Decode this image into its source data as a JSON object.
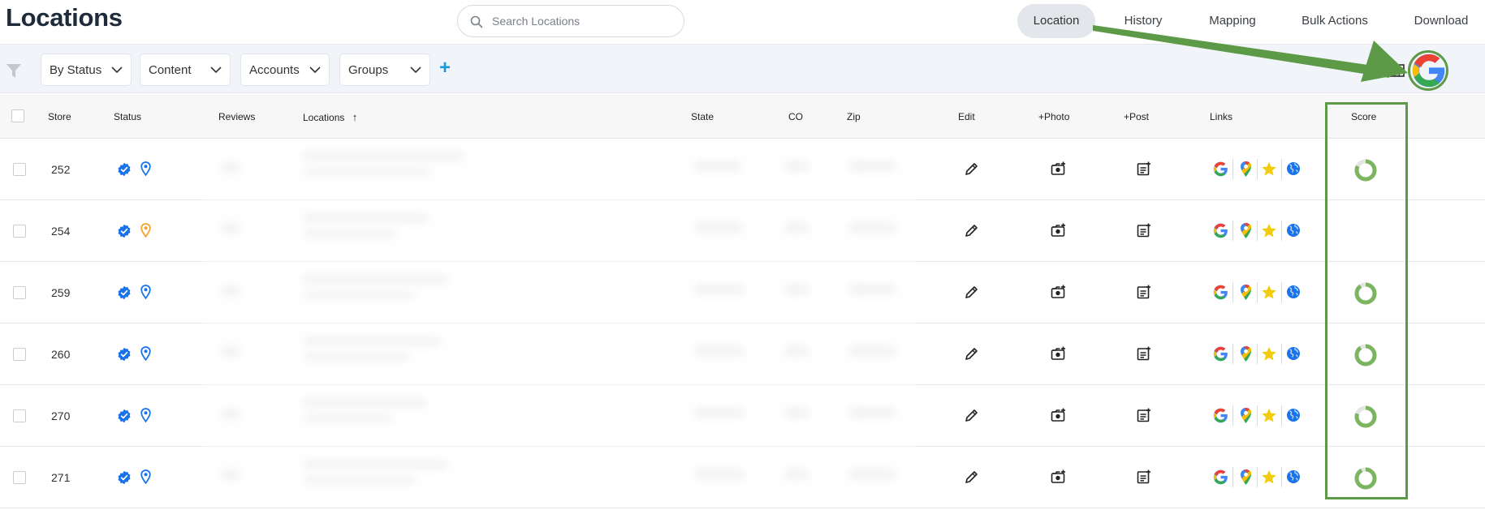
{
  "page": {
    "title": "Locations"
  },
  "search": {
    "placeholder": "Search Locations"
  },
  "nav": {
    "tabs": [
      {
        "label": "Location",
        "active": true
      },
      {
        "label": "History"
      },
      {
        "label": "Mapping"
      },
      {
        "label": "Bulk Actions"
      },
      {
        "label": "Download"
      }
    ]
  },
  "filters": {
    "dropdowns": [
      {
        "label": "By Status"
      },
      {
        "label": "Content"
      },
      {
        "label": "Accounts"
      },
      {
        "label": "Groups"
      }
    ],
    "add_label": "+"
  },
  "table": {
    "columns": {
      "store": "Store",
      "status": "Status",
      "reviews": "Reviews",
      "locations": "Locations",
      "state": "State",
      "co": "CO",
      "zip": "Zip",
      "edit": "Edit",
      "photo": "+Photo",
      "post": "+Post",
      "links": "Links",
      "score": "Score"
    },
    "sort_indicator": "↑",
    "rows": [
      {
        "store": "252",
        "pin_color": "#1a73e8",
        "score": 0.82
      },
      {
        "store": "254",
        "pin_color": "#f4a22d",
        "score": null
      },
      {
        "store": "259",
        "pin_color": "#1a73e8",
        "score": 0.9
      },
      {
        "store": "260",
        "pin_color": "#1a73e8",
        "score": 0.9
      },
      {
        "store": "270",
        "pin_color": "#1a73e8",
        "score": 0.8
      },
      {
        "store": "271",
        "pin_color": "#1a73e8",
        "score": 0.92
      }
    ]
  },
  "icons": {
    "search": "search-icon",
    "filter": "filter-icon",
    "chevron": "chevron-down-icon",
    "verified": "verified-badge-icon",
    "pin": "map-pin-icon",
    "edit": "pencil-icon",
    "photo": "add-photo-icon",
    "post": "add-post-icon",
    "google": "google-icon",
    "maps": "google-maps-icon",
    "star": "star-icon",
    "globe": "globe-icon",
    "grid": "grid-icon"
  },
  "colors": {
    "accent_blue": "#1a73e8",
    "annotation_green": "#5d9a48",
    "score_green": "#7cb55f",
    "star_yellow": "#f2cc0c"
  }
}
